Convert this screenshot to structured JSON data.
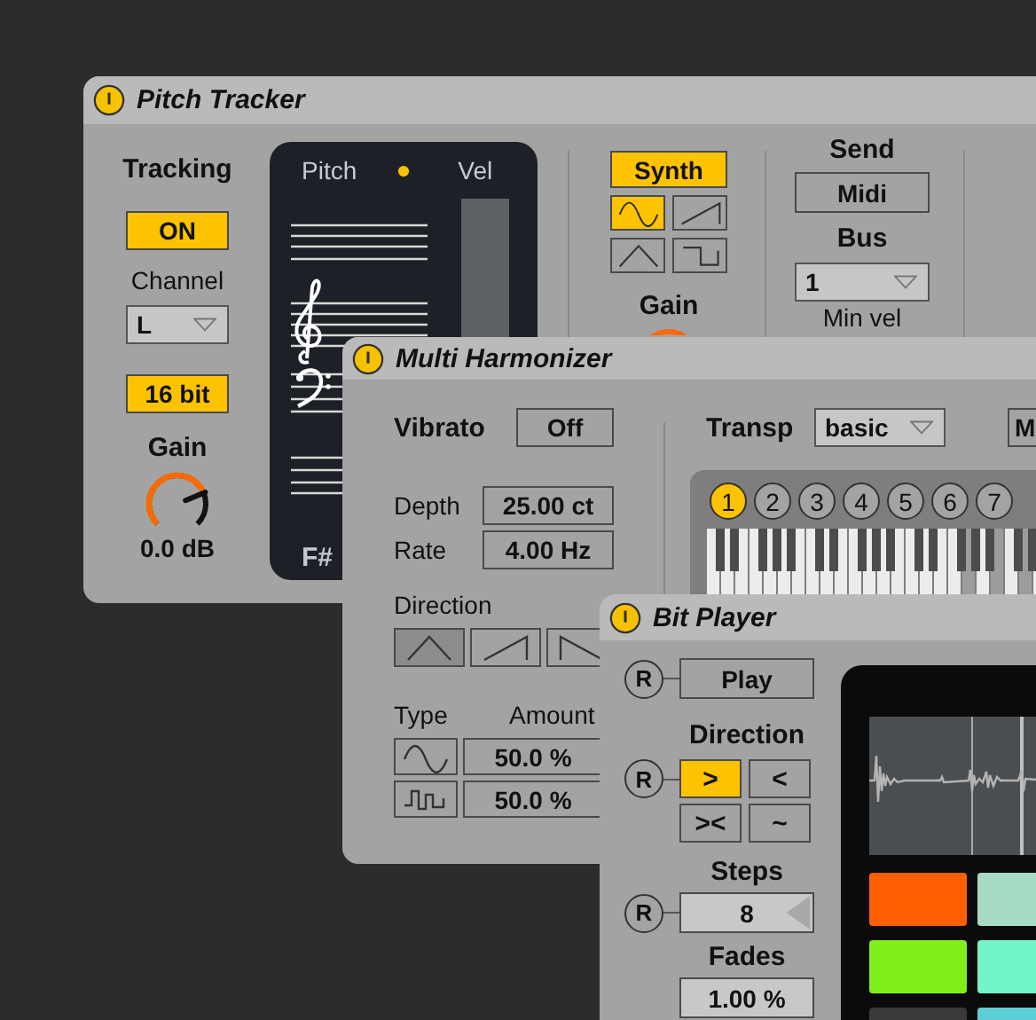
{
  "pitch_tracker": {
    "title": "Pitch Tracker",
    "power_on": true,
    "tracking": {
      "label": "Tracking",
      "button": "ON",
      "on": true
    },
    "channel": {
      "label": "Channel",
      "value": "L"
    },
    "bit_depth": {
      "label": "16 bit",
      "on": true
    },
    "gain": {
      "label": "Gain",
      "level": 0.75,
      "reading": "0.0 dB"
    },
    "display": {
      "pitch_label": "Pitch",
      "vel_label": "Vel",
      "note": "F#"
    },
    "synth": {
      "button": "Synth",
      "on": true,
      "gain_label": "Gain",
      "waves": [
        {
          "kind": "sine",
          "selected": true
        },
        {
          "kind": "saw",
          "selected": false
        },
        {
          "kind": "triangle",
          "selected": false
        },
        {
          "kind": "square",
          "selected": false
        }
      ]
    },
    "send": {
      "label": "Send",
      "button": "Midi",
      "bus_label": "Bus",
      "bus": "1",
      "min_vel_label": "Min vel"
    }
  },
  "multi_harmonizer": {
    "title": "Multi Harmonizer",
    "power_on": true,
    "vibrato": {
      "label": "Vibrato",
      "button": "Off",
      "on": false
    },
    "depth": {
      "label": "Depth",
      "value": "25.00 ct"
    },
    "rate": {
      "label": "Rate",
      "value": "4.00 Hz"
    },
    "direction": {
      "label": "Direction",
      "options": [
        {
          "kind": "triangle",
          "selected": true
        },
        {
          "kind": "ramp-up",
          "selected": false
        },
        {
          "kind": "ramp-down",
          "selected": false
        }
      ]
    },
    "type_label": "Type",
    "amount_label": "Amount",
    "modulators": [
      {
        "kind": "sine",
        "amount": "50.0 %"
      },
      {
        "kind": "steps",
        "amount": "50.0 %"
      }
    ],
    "transp": {
      "label": "Transp",
      "value": "basic"
    },
    "mode_button": "M",
    "voices": [
      {
        "label": "1",
        "selected": true
      },
      {
        "label": "2",
        "selected": false
      },
      {
        "label": "3",
        "selected": false
      },
      {
        "label": "4",
        "selected": false
      },
      {
        "label": "5",
        "selected": false
      },
      {
        "label": "6",
        "selected": false
      },
      {
        "label": "7",
        "selected": false
      }
    ]
  },
  "bit_player": {
    "title": "Bit Player",
    "power_on": true,
    "play": {
      "reset": "R",
      "button": "Play"
    },
    "direction": {
      "label": "Direction",
      "reset": "R",
      "options": [
        {
          "label": ">",
          "selected": true
        },
        {
          "label": "<",
          "selected": false
        },
        {
          "label": "><",
          "selected": false
        },
        {
          "label": "~",
          "selected": false
        }
      ]
    },
    "steps": {
      "label": "Steps",
      "reset": "R",
      "value": "8"
    },
    "fades": {
      "label": "Fades",
      "value": "1.00 %"
    },
    "pads": [
      {
        "color": "#ff6000"
      },
      {
        "color": "#a6dcc6"
      },
      {
        "color": "#80f01a"
      },
      {
        "color": "#72f5c8"
      },
      {
        "color": "#3a3a3a"
      },
      {
        "color": "#5ccfd6"
      }
    ]
  }
}
